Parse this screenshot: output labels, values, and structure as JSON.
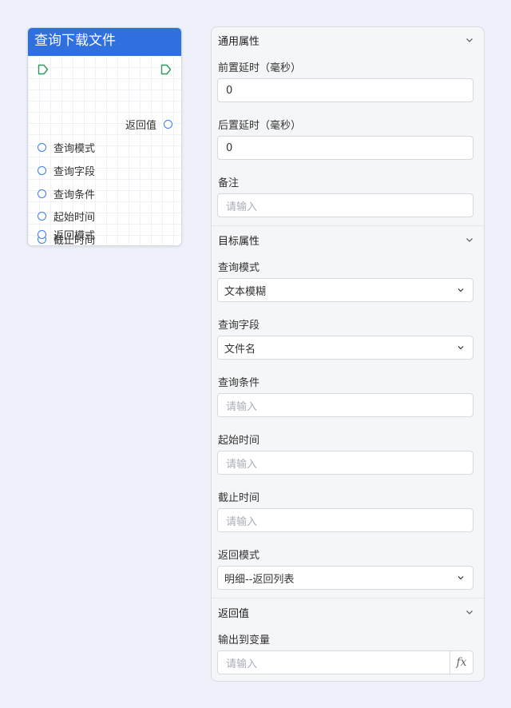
{
  "node": {
    "title": "查询下载文件",
    "output_port": "返回值",
    "input_ports": [
      "查询模式",
      "查询字段",
      "查询条件",
      "起始时间",
      "截止时间",
      "返回模式"
    ]
  },
  "panel": {
    "general": {
      "title": "通用属性",
      "pre_delay_label": "前置延时（毫秒）",
      "pre_delay_value": "0",
      "post_delay_label": "后置延时（毫秒）",
      "post_delay_value": "0",
      "note_label": "备注",
      "note_placeholder": "请输入"
    },
    "target": {
      "title": "目标属性",
      "query_mode_label": "查询模式",
      "query_mode_value": "文本模糊",
      "query_field_label": "查询字段",
      "query_field_value": "文件名",
      "query_condition_label": "查询条件",
      "query_condition_placeholder": "请输入",
      "start_time_label": "起始时间",
      "start_time_placeholder": "请输入",
      "end_time_label": "截止时间",
      "end_time_placeholder": "请输入",
      "return_mode_label": "返回模式",
      "return_mode_value": "明细--返回列表"
    },
    "return": {
      "title": "返回值",
      "output_var_label": "输出到变量",
      "output_var_placeholder": "请输入",
      "fx_label": "fx"
    }
  },
  "colors": {
    "accent": "#2f6fe0",
    "port_blue": "#3b7cf0",
    "flow_green": "#2e9b5a",
    "page_bg": "#eef1f9",
    "panel_bg": "#f5f6f8"
  },
  "icons": {
    "flow_in": "flow-in-icon",
    "flow_out": "flow-out-icon",
    "section_toggle": "chevron-down-icon",
    "select_toggle": "chevron-down-icon",
    "expression": "fx-icon"
  }
}
